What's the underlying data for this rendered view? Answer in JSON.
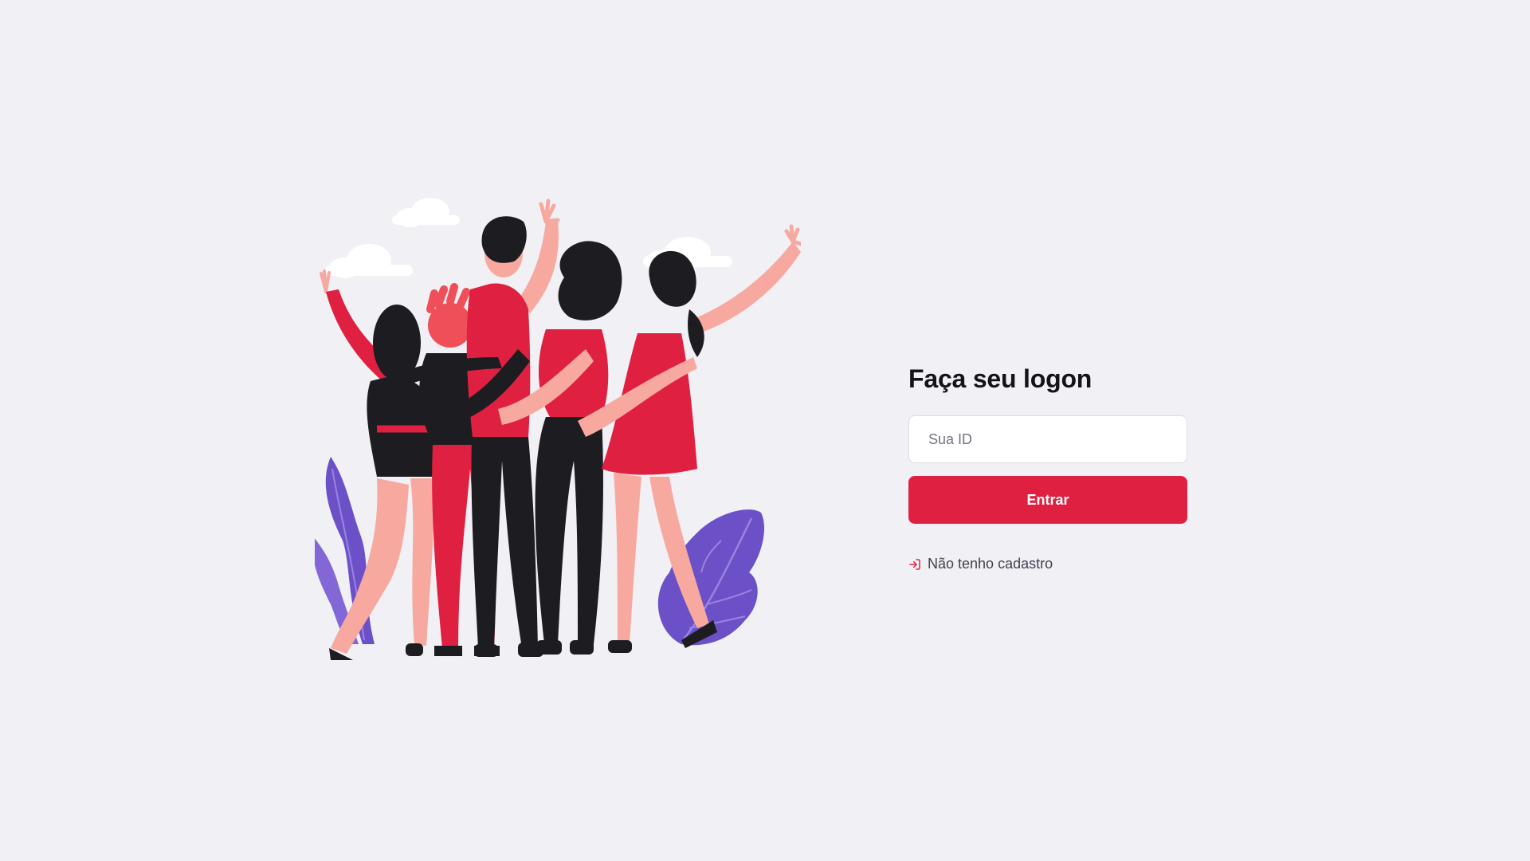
{
  "colors": {
    "background": "#f0f0f5",
    "accent": "#e02041",
    "title": "#13131a",
    "text": "#41414d"
  },
  "hero": {
    "icon": "people-celebrating-illustration"
  },
  "login": {
    "title": "Faça seu logon",
    "id_placeholder": "Sua ID",
    "id_value": "",
    "submit_label": "Entrar",
    "register_label": "Não tenho cadastro",
    "register_icon": "log-in-icon"
  }
}
